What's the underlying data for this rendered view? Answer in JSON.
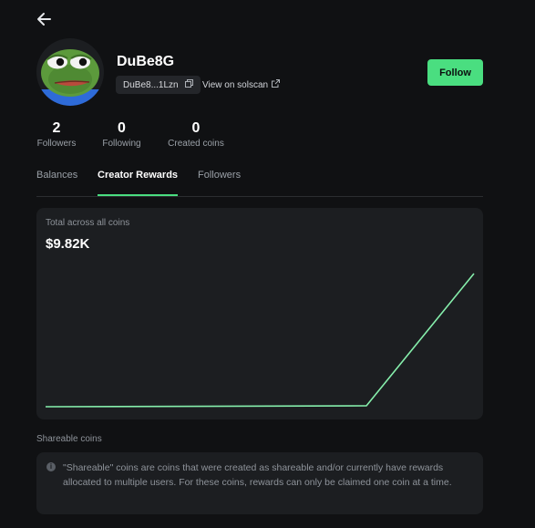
{
  "profile": {
    "name": "DuBe8G",
    "address_short": "DuBe8...1Lzn",
    "solscan_label": "View on solscan",
    "follow_label": "Follow"
  },
  "stats": [
    {
      "value": "2",
      "label": "Followers"
    },
    {
      "value": "0",
      "label": "Following"
    },
    {
      "value": "0",
      "label": "Created coins"
    }
  ],
  "tabs": [
    {
      "label": "Balances",
      "active": false
    },
    {
      "label": "Creator Rewards",
      "active": true
    },
    {
      "label": "Followers",
      "active": false
    }
  ],
  "rewards": {
    "total_label": "Total across all coins",
    "total_value": "$9.82K",
    "line_color": "#86efac",
    "trend_shape": "flat near zero, then a sharp rise at the end"
  },
  "shareable": {
    "title": "Shareable coins",
    "note": "\"Shareable\" coins are coins that were created as shareable and/or currently have rewards allocated to multiple users. For these coins, rewards can only be claimed one coin at a time."
  },
  "colors": {
    "background": "#101113",
    "card": "#1c1e21",
    "accent": "#4ade80"
  }
}
